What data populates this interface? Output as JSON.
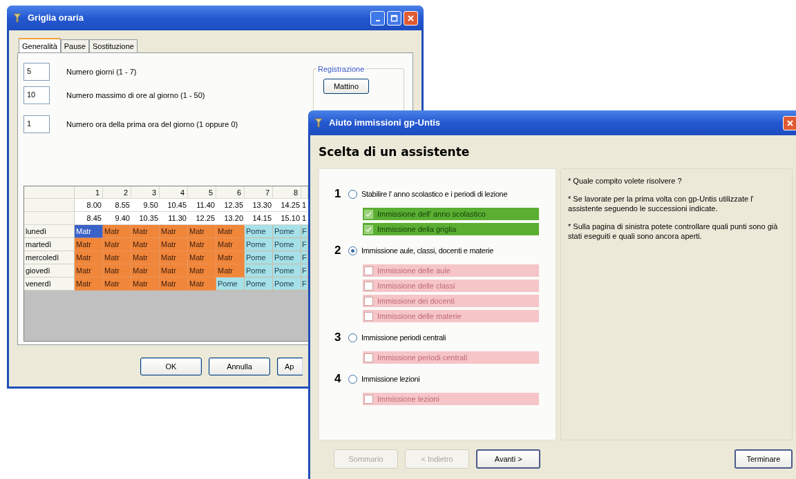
{
  "grid_window": {
    "title": "Griglia oraria",
    "tabs": [
      {
        "label": "Generalità",
        "selected": true
      },
      {
        "label": "Pause",
        "selected": false
      },
      {
        "label": "Sostituzione",
        "selected": false
      }
    ],
    "fields": [
      {
        "value": "5",
        "label": "Numero giorni (1 - 7)"
      },
      {
        "value": "10",
        "label": "Numero massimo di ore al giorno (1 - 50)"
      },
      {
        "value": "1",
        "label": "Numero ora della prima ora del giorno (1 oppure 0)"
      }
    ],
    "registration": {
      "title": "Registrazione",
      "button": "Mattino"
    },
    "grid": {
      "columns": [
        "1",
        "2",
        "3",
        "4",
        "5",
        "6",
        "7",
        "8",
        ""
      ],
      "start_times": [
        "8.00",
        "8.55",
        "9.50",
        "10.45",
        "11.40",
        "12.35",
        "13.30",
        "14.25",
        "1"
      ],
      "end_times": [
        "8.45",
        "9.40",
        "10.35",
        "11.30",
        "12.25",
        "13.20",
        "14.15",
        "15.10",
        "1"
      ],
      "rows": [
        {
          "day": "lunedì",
          "cells": [
            {
              "text": "Matr",
              "kind": "morning",
              "selected": true
            },
            {
              "text": "Matr",
              "kind": "morning",
              "selected": false
            },
            {
              "text": "Matr",
              "kind": "morning",
              "selected": false
            },
            {
              "text": "Matr",
              "kind": "morning",
              "selected": false
            },
            {
              "text": "Matr",
              "kind": "morning",
              "selected": false
            },
            {
              "text": "Matr",
              "kind": "morning",
              "selected": false
            },
            {
              "text": "Pome",
              "kind": "afternoon",
              "selected": false
            },
            {
              "text": "Pome",
              "kind": "afternoon",
              "selected": false
            },
            {
              "text": "F",
              "kind": "afternoon",
              "selected": false
            }
          ]
        },
        {
          "day": "martedì",
          "cells": [
            {
              "text": "Matr",
              "kind": "morning",
              "selected": false
            },
            {
              "text": "Matr",
              "kind": "morning",
              "selected": false
            },
            {
              "text": "Matr",
              "kind": "morning",
              "selected": false
            },
            {
              "text": "Matr",
              "kind": "morning",
              "selected": false
            },
            {
              "text": "Matr",
              "kind": "morning",
              "selected": false
            },
            {
              "text": "Matr",
              "kind": "morning",
              "selected": false
            },
            {
              "text": "Pome",
              "kind": "afternoon",
              "selected": false
            },
            {
              "text": "Pome",
              "kind": "afternoon",
              "selected": false
            },
            {
              "text": "F",
              "kind": "afternoon",
              "selected": false
            }
          ]
        },
        {
          "day": "mercoledì",
          "cells": [
            {
              "text": "Matr",
              "kind": "morning",
              "selected": false
            },
            {
              "text": "Matr",
              "kind": "morning",
              "selected": false
            },
            {
              "text": "Matr",
              "kind": "morning",
              "selected": false
            },
            {
              "text": "Matr",
              "kind": "morning",
              "selected": false
            },
            {
              "text": "Matr",
              "kind": "morning",
              "selected": false
            },
            {
              "text": "Matr",
              "kind": "morning",
              "selected": false
            },
            {
              "text": "Pome",
              "kind": "afternoon",
              "selected": false
            },
            {
              "text": "Pome",
              "kind": "afternoon",
              "selected": false
            },
            {
              "text": "F",
              "kind": "afternoon",
              "selected": false
            }
          ]
        },
        {
          "day": "giovedì",
          "cells": [
            {
              "text": "Matr",
              "kind": "morning",
              "selected": false
            },
            {
              "text": "Matr",
              "kind": "morning",
              "selected": false
            },
            {
              "text": "Matr",
              "kind": "morning",
              "selected": false
            },
            {
              "text": "Matr",
              "kind": "morning",
              "selected": false
            },
            {
              "text": "Matr",
              "kind": "morning",
              "selected": false
            },
            {
              "text": "Matr",
              "kind": "morning",
              "selected": false
            },
            {
              "text": "Pome",
              "kind": "afternoon",
              "selected": false
            },
            {
              "text": "Pome",
              "kind": "afternoon",
              "selected": false
            },
            {
              "text": "F",
              "kind": "afternoon",
              "selected": false
            }
          ]
        },
        {
          "day": "venerdì",
          "cells": [
            {
              "text": "Matr",
              "kind": "morning",
              "selected": false
            },
            {
              "text": "Matr",
              "kind": "morning",
              "selected": false
            },
            {
              "text": "Matr",
              "kind": "morning",
              "selected": false
            },
            {
              "text": "Matr",
              "kind": "morning",
              "selected": false
            },
            {
              "text": "Matr",
              "kind": "morning",
              "selected": false
            },
            {
              "text": "Pome",
              "kind": "afternoon",
              "selected": false
            },
            {
              "text": "Pome",
              "kind": "afternoon",
              "selected": false
            },
            {
              "text": "Pome",
              "kind": "afternoon",
              "selected": false
            },
            {
              "text": "F",
              "kind": "afternoon",
              "selected": false
            }
          ]
        }
      ]
    },
    "buttons": [
      "OK",
      "Annulla",
      "Ap"
    ]
  },
  "wizard_window": {
    "title": "Aiuto immissioni gp-Untis",
    "heading": "Scelta di un assistente",
    "steps": [
      {
        "number": "1",
        "label": "Stabilire l' anno scolastico e i periodi di lezione",
        "selected": false,
        "tasks": [
          {
            "label": "Immissione dell' anno scolastico",
            "checked": true
          },
          {
            "label": "Immissione della griglia",
            "checked": true
          }
        ]
      },
      {
        "number": "2",
        "label": "Immissione aule, classi, docenti e materie",
        "selected": true,
        "tasks": [
          {
            "label": "Immissione delle aule",
            "checked": false
          },
          {
            "label": "Immissione delle classi",
            "checked": false
          },
          {
            "label": "Immissione dei docenti",
            "checked": false
          },
          {
            "label": "Immissione delle materie",
            "checked": false
          }
        ]
      },
      {
        "number": "3",
        "label": "Immissione periodi centrali",
        "selected": false,
        "tasks": [
          {
            "label": "Immissione periodi centrali",
            "checked": false
          }
        ]
      },
      {
        "number": "4",
        "label": "Immissione lezioni",
        "selected": false,
        "tasks": [
          {
            "label": "Immissione lezioni",
            "checked": false
          }
        ]
      }
    ],
    "hints": [
      "* Quale compito volete risolvere ?",
      "* Se lavorate per la prima volta con gp-Untis utilizzate l' assistente seguendo le successioni indicate.",
      "* Sulla pagina di sinistra potete controllare quali punti sono già stati eseguiti e quali sono ancora aperti."
    ],
    "buttons": [
      {
        "label": "Sommario",
        "disabled": true
      },
      {
        "label": "< Indietro",
        "disabled": true
      },
      {
        "label": "Avanti >",
        "disabled": false
      }
    ],
    "finish_button": "Terminare"
  }
}
